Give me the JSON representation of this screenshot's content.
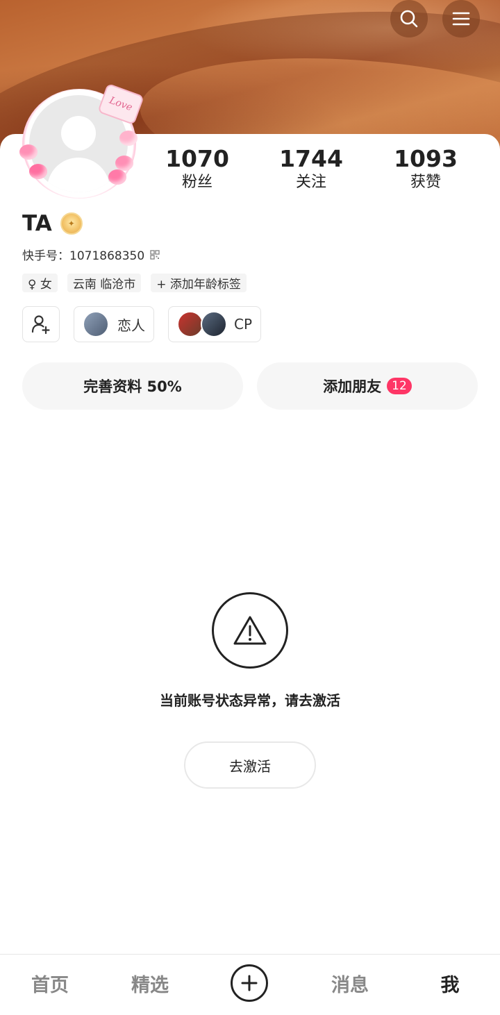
{
  "header": {
    "search_icon": "search-icon",
    "menu_icon": "menu-icon"
  },
  "profile": {
    "avatar_deco_text": "Love",
    "name": "TA",
    "id_label": "快手号：1071868350",
    "stats": [
      {
        "value": "1070",
        "label": "粉丝"
      },
      {
        "value": "1744",
        "label": "关注"
      },
      {
        "value": "1093",
        "label": "获赞"
      }
    ],
    "tags": [
      "♀ 女",
      "云南 临沧市",
      "+ 添加年龄标签"
    ],
    "relations": [
      {
        "label": "恋人"
      },
      {
        "label": "CP"
      }
    ],
    "complete_profile": "完善资料 50%",
    "add_friends": "添加朋友",
    "add_friends_count": "12"
  },
  "notice": {
    "message": "当前账号状态异常，请去激活",
    "button": "去激活"
  },
  "tabbar": {
    "items": [
      "首页",
      "精选",
      "消息",
      "我"
    ]
  },
  "colors": {
    "accent": "#fe3666",
    "text": "#222222",
    "muted": "#888888"
  }
}
